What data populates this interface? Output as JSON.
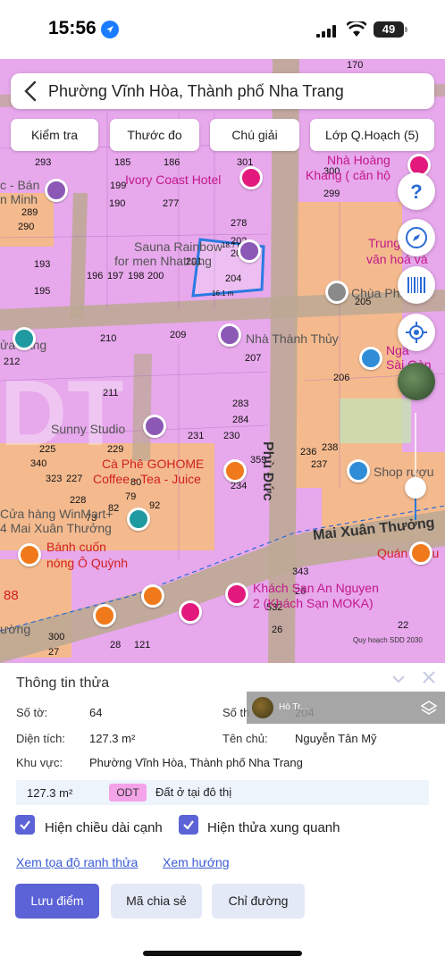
{
  "status_bar": {
    "time": "15:56",
    "battery": "49"
  },
  "search": {
    "title": "Phường Vĩnh Hòa, Thành phố Nha Trang"
  },
  "tools": [
    "Kiểm tra",
    "Thước đo",
    "Chú giải",
    "Lớp Q.Hoạch (5)"
  ],
  "map": {
    "parcel_numbers": [
      "293",
      "185",
      "186",
      "301",
      "300",
      "199",
      "299",
      "190",
      "277",
      "278",
      "289",
      "290",
      "202",
      "203",
      "193",
      "201",
      "204",
      "196",
      "197",
      "198",
      "200",
      "195",
      "205",
      "210",
      "209",
      "207",
      "212",
      "206",
      "211",
      "283",
      "284",
      "230",
      "231",
      "225",
      "229",
      "238",
      "236",
      "237",
      "340",
      "227",
      "323",
      "359",
      "234",
      "228",
      "79",
      "80",
      "92",
      "82",
      "73",
      "343",
      "26",
      "532",
      "300",
      "27",
      "28",
      "121",
      "26",
      "22",
      "88",
      "170"
    ],
    "poi_labels": {
      "ivory": "Ivory Coast Hotel",
      "sauna": "Sauna Rainbow",
      "sauna2": "for men Nhatrang",
      "nha_thanh_thuy": "Nhà Thành Thủy",
      "sunny": "Sunny Studio",
      "cafe": "Cà Phê GOHOME",
      "cafe2": "Coffee - Tea - Juice",
      "winmart": "Cửa hàng WinMart+",
      "winmart2": "4 Mai Xuân Thưởng",
      "banh_cuon": "Bánh cuốn",
      "banh_cuon2": "nóng Ô Quỳnh",
      "khach_san": "Khách Sạn An Nguyen",
      "khach_san2": "2 (Khách Sạn MOKA)",
      "chua": "Chùa Phước",
      "trung": "Trung",
      "van_hoa": "văn hoá và",
      "shop": "Shop rượu",
      "quan_nhau": "Quán nhậu",
      "hoang": "Nhà Hoàng",
      "khang": "Khang ( căn hộ",
      "nga": "Ngã",
      "sai_gon": "Sài Gòn",
      "bac": "c - Bán",
      "minh": "n Minh",
      "ua_hang": "ửa hàng",
      "ong": "ường",
      "ng": "ng",
      "dim": "Mai Xuân Thưởng"
    },
    "streets": {
      "phu_duc": "Phù Đức",
      "mai_xuan_thuong": "Mai Xuân Thưởng"
    },
    "parcel_big": "DT",
    "measure_top": "18.7 m",
    "measure_bottom": "16.1 m",
    "attribution": "Quy hoạch SDD 2030"
  },
  "info": {
    "title": "Thông tin thửa",
    "so_to_label": "Số tờ:",
    "so_to_value": "64",
    "so_thua_label": "Số th",
    "so_thua_value": "204",
    "dien_tich_label": "Diện tích:",
    "dien_tich_value": "127.3 m²",
    "ten_chu_label": "Tên chủ:",
    "ten_chu_value": "Nguyễn Tân Mỹ",
    "khu_vuc_label": "Khu vực:",
    "khu_vuc_value": "Phường Vĩnh Hòa, Thành phố Nha Trang",
    "land_area": "127.3 m²",
    "land_code": "ODT",
    "land_type": "Đất ở tại đô thị",
    "check1": "Hiện chiều dài cạnh",
    "check2": "Hiện thửa xung quanh",
    "link1": "Xem tọa độ ranh thửa",
    "link2": "Xem hướng",
    "btn_save": "Lưu điểm",
    "btn_share": "Mã chia sẻ",
    "btn_route": "Chỉ đường"
  },
  "street_view": {
    "text": "Hò Tr..."
  },
  "colors": {
    "residential": "#e7a8ec",
    "road": "#bca893",
    "commercial": "#f4ba8e",
    "accent": "#5b63d6",
    "parcel_outline": "#2a7ae2"
  }
}
